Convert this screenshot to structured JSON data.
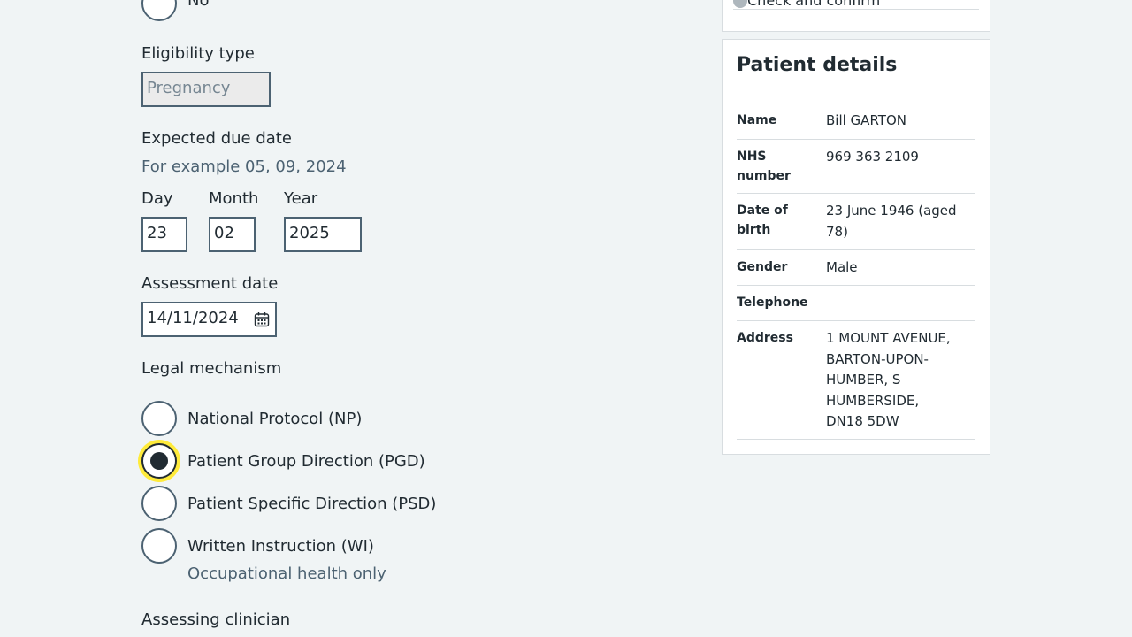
{
  "form": {
    "top_radio_no": "No",
    "eligibility_label": "Eligibility type",
    "eligibility_value": "Pregnancy",
    "due_date_label": "Expected due date",
    "due_date_hint": "For example 05, 09, 2024",
    "day_label": "Day",
    "day_value": "23",
    "month_label": "Month",
    "month_value": "02",
    "year_label": "Year",
    "year_value": "2025",
    "assessment_label": "Assessment date",
    "assessment_value": "14/11/2024",
    "legal_label": "Legal mechanism",
    "legal_options": [
      {
        "label": "National Protocol (NP)",
        "checked": false
      },
      {
        "label": "Patient Group Direction (PGD)",
        "checked": true
      },
      {
        "label": "Patient Specific Direction (PSD)",
        "checked": false
      },
      {
        "label": "Written Instruction (WI)",
        "checked": false
      }
    ],
    "wi_hint": "Occupational health only",
    "clinician_label": "Assessing clinician"
  },
  "sidebar": {
    "top_item": "Check and confirm",
    "title": "Patient details",
    "rows": [
      {
        "key": "Name",
        "value": "Bill GARTON"
      },
      {
        "key": "NHS number",
        "value": "969 363 2109"
      },
      {
        "key": "Date of birth",
        "value": "23 June 1946 (aged 78)"
      },
      {
        "key": "Gender",
        "value": "Male"
      },
      {
        "key": "Telephone",
        "value": ""
      },
      {
        "key": "Address",
        "value": "1 MOUNT AVENUE, BARTON-UPON-HUMBER, S HUMBERSIDE, DN18 5DW"
      }
    ]
  },
  "colors": {
    "focus": "#ffeb3b",
    "hint": "#4c6272",
    "border": "#4c6272"
  },
  "icons": {
    "calendar": "calendar-icon",
    "status": "status-dot-icon"
  }
}
